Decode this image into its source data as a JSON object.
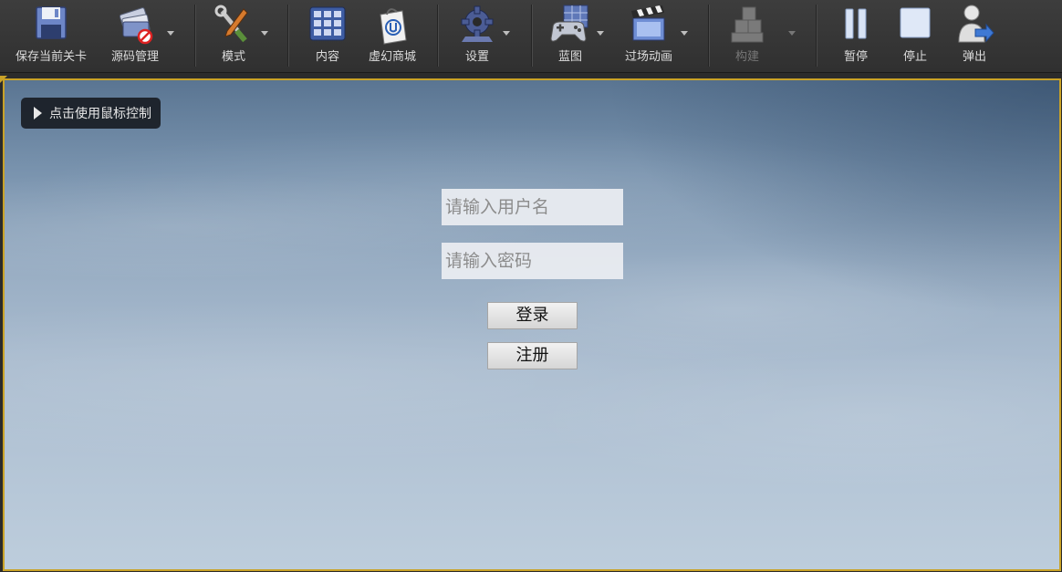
{
  "toolbar": {
    "save": {
      "label": "保存当前关卡",
      "icon": "floppy-disk-icon"
    },
    "source_control": {
      "label": "源码管理",
      "icon": "source-control-icon"
    },
    "modes": {
      "label": "模式",
      "icon": "modes-tools-icon"
    },
    "content": {
      "label": "内容",
      "icon": "content-grid-icon"
    },
    "marketplace": {
      "label": "虚幻商城",
      "icon": "marketplace-bag-icon"
    },
    "settings": {
      "label": "设置",
      "icon": "gear-icon"
    },
    "blueprints": {
      "label": "蓝图",
      "icon": "gamepad-icon"
    },
    "cinematics": {
      "label": "过场动画",
      "icon": "clapperboard-icon"
    },
    "build": {
      "label": "构建",
      "icon": "build-blocks-icon",
      "enabled": false
    },
    "pause": {
      "label": "暂停",
      "icon": "pause-icon"
    },
    "stop": {
      "label": "停止",
      "icon": "stop-icon"
    },
    "eject": {
      "label": "弹出",
      "icon": "eject-person-icon"
    }
  },
  "viewport": {
    "mouse_hint": "点击使用鼠标控制",
    "username_placeholder": "请输入用户名",
    "password_placeholder": "请输入密码",
    "login_label": "登录",
    "register_label": "注册"
  },
  "colors": {
    "toolbar_bg": "#353535",
    "viewport_border": "#c9a227",
    "sky_top": "#5a7592",
    "sky_bottom": "#bdcddc"
  }
}
